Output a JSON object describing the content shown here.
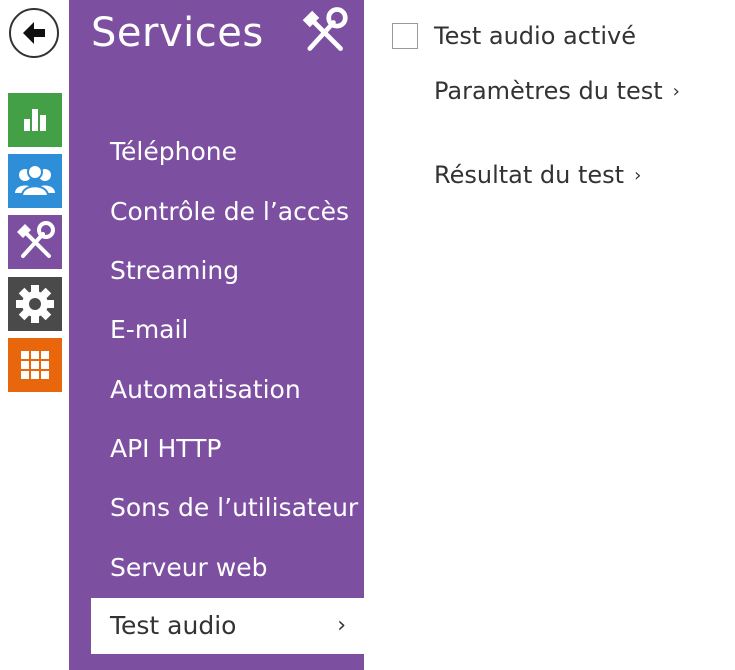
{
  "rail": {
    "items": [
      {
        "icon": "back-arrow-icon"
      },
      {
        "icon": "bar-chart-icon",
        "color": "#43a047"
      },
      {
        "icon": "users-icon",
        "color": "#2e8fd8"
      },
      {
        "icon": "hammer-wrench-icon",
        "color": "#7c4fa1"
      },
      {
        "icon": "gear-icon",
        "color": "#4a4a4a"
      },
      {
        "icon": "grid-icon",
        "color": "#e8670c"
      }
    ]
  },
  "sidebar": {
    "title": "Services",
    "accent": "#7c4fa1",
    "items": [
      {
        "label": "Téléphone"
      },
      {
        "label": "Contrôle de l’accès"
      },
      {
        "label": "Streaming"
      },
      {
        "label": "E-mail"
      },
      {
        "label": "Automatisation"
      },
      {
        "label": "API HTTP"
      },
      {
        "label": "Sons de l’utilisateur"
      },
      {
        "label": "Serveur web"
      },
      {
        "label": "Test audio",
        "active": true
      }
    ],
    "chevron": "›"
  },
  "content": {
    "checkbox_label": "Test audio activé",
    "checkbox_checked": false,
    "links": [
      {
        "label": "Paramètres du test"
      },
      {
        "label": "Résultat du test"
      }
    ],
    "chevron": "›"
  }
}
